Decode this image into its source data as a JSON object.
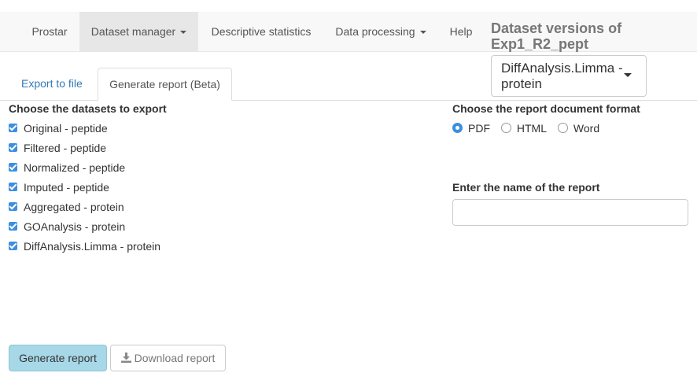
{
  "navbar": {
    "brand": "Prostar",
    "items": [
      {
        "label": "Dataset manager",
        "dropdown": true,
        "active": true
      },
      {
        "label": "Descriptive statistics",
        "dropdown": false,
        "active": false
      },
      {
        "label": "Data processing",
        "dropdown": true,
        "active": false
      },
      {
        "label": "Help",
        "dropdown": false,
        "active": false
      }
    ],
    "versions_title_line1": "Dataset versions of",
    "versions_title_line2": "Exp1_R2_pept",
    "versions_selected_line1": "DiffAnalysis.Limma -",
    "versions_selected_line2": "protein"
  },
  "tabs": [
    {
      "label": "Export to file",
      "active": false
    },
    {
      "label": "Generate report (Beta)",
      "active": true
    }
  ],
  "datasets": {
    "label": "Choose the datasets to export",
    "items": [
      {
        "label": "Original - peptide",
        "checked": true
      },
      {
        "label": "Filtered - peptide",
        "checked": true
      },
      {
        "label": "Normalized - peptide",
        "checked": true
      },
      {
        "label": "Imputed - peptide",
        "checked": true
      },
      {
        "label": "Aggregated - protein",
        "checked": true
      },
      {
        "label": "GOAnalysis - protein",
        "checked": true
      },
      {
        "label": "DiffAnalysis.Limma - protein",
        "checked": true
      }
    ]
  },
  "format": {
    "label": "Choose the report document format",
    "options": [
      "PDF",
      "HTML",
      "Word"
    ],
    "selected": "PDF"
  },
  "report_name": {
    "label": "Enter the name of the report",
    "value": ""
  },
  "buttons": {
    "generate": "Generate report",
    "download": "Download report"
  },
  "colors": {
    "accent": "#3b8fe0",
    "primary_button": "#a7d8e8",
    "link": "#337ab7"
  }
}
